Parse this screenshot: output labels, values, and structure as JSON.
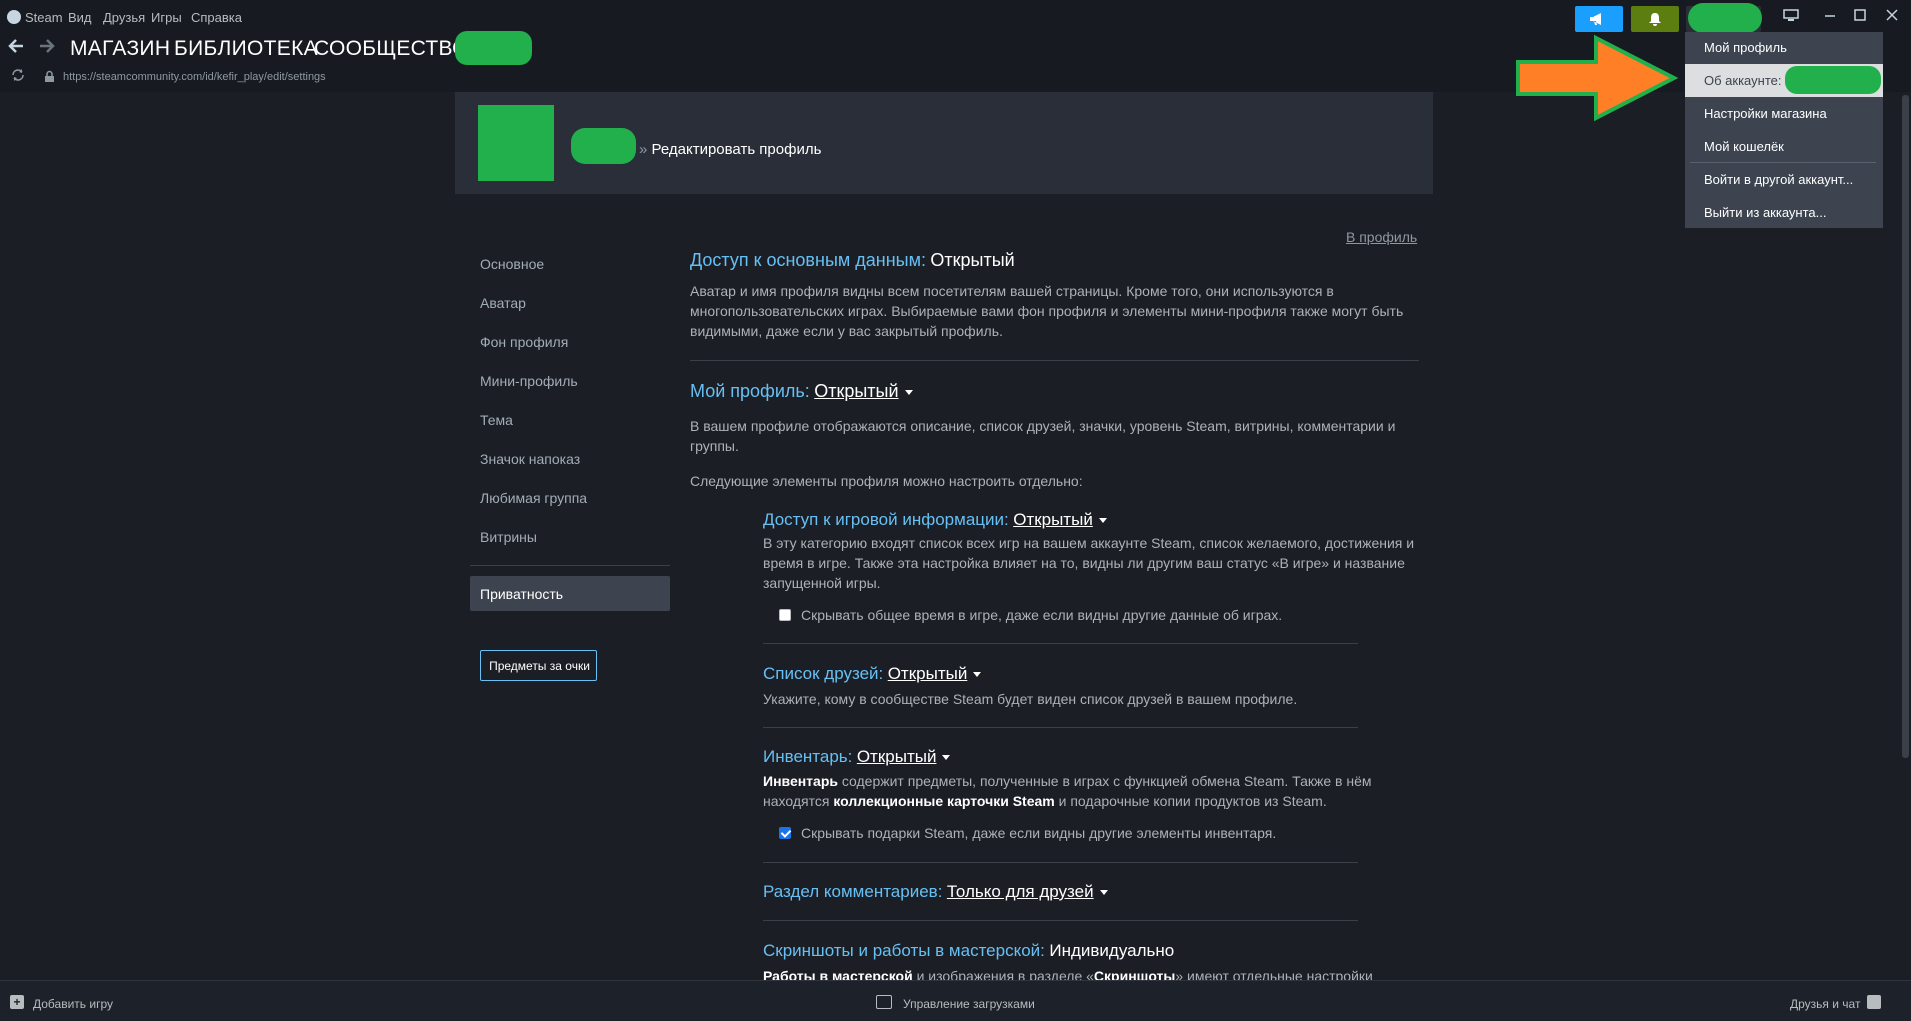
{
  "menubar": {
    "app_name": "Steam",
    "items": [
      "Вид",
      "Друзья",
      "Игры",
      "Справка"
    ]
  },
  "nav": {
    "links": [
      "МАГАЗИН",
      "БИБЛИОТЕКА",
      "СООБЩЕСТВО"
    ],
    "url": "https://steamcommunity.com/id/kefir_play/edit/settings"
  },
  "header": {
    "separator": "»",
    "edit_profile": "Редактировать профиль"
  },
  "to_profile_link": "В профиль",
  "sidebar": {
    "items": [
      "Основное",
      "Аватар",
      "Фон профиля",
      "Мини-профиль",
      "Тема",
      "Значок напоказ",
      "Любимая группа",
      "Витрины"
    ],
    "active": "Приватность",
    "points_button": "Предметы за очки"
  },
  "privacy": {
    "basic": {
      "label": "Доступ к основным данным:",
      "value": "Открытый",
      "desc_lines": [
        "Аватар и имя профиля видны всем посетителям вашей страницы. Кроме того, они используются в",
        "многопользовательских играх. Выбираемые вами фон профиля и элементы мини-профиля также могут быть",
        "видимыми, даже если у вас закрытый профиль."
      ]
    },
    "profile": {
      "label": "Мой профиль:",
      "value": "Открытый",
      "desc_lines": [
        "В вашем профиле отображаются описание, список друзей, значки, уровень Steam, витрины, комментарии и",
        "группы."
      ],
      "note": "Следующие элементы профиля можно настроить отдельно:"
    },
    "game_details": {
      "label": "Доступ к игровой информации:",
      "value": "Открытый",
      "desc_lines": [
        "В эту категорию входят список всех игр на вашем аккаунте Steam, список желаемого, достижения и",
        "время в игре. Также эта настройка влияет на то, видны ли другим ваш статус «В игре» и название",
        "запущенной игры."
      ],
      "checkbox_label": "Скрывать общее время в игре, даже если видны другие данные об играх.",
      "checked": false
    },
    "friends": {
      "label": "Список друзей:",
      "value": "Открытый",
      "desc": "Укажите, кому в сообществе Steam будет виден список друзей в вашем профиле."
    },
    "inventory": {
      "label": "Инвентарь:",
      "value": "Открытый",
      "line1_bold": "Инвентарь",
      "line1_rest": " содержит предметы, полученные в играх с функцией обмена Steam. Также в нём",
      "line2_pre": "находятся ",
      "line2_bold": "коллекционные карточки Steam",
      "line2_rest": " и подарочные копии продуктов из Steam.",
      "checkbox_label": "Скрывать подарки Steam, даже если видны другие элементы инвентаря.",
      "checked": true
    },
    "comments": {
      "label": "Раздел комментариев:",
      "value": "Только для друзей"
    },
    "screenshots": {
      "label": "Скриншоты и работы в мастерской:",
      "value": "Индивидуально",
      "line_bold1": "Работы в мастерской",
      "line_mid": " и изображения в разделе «",
      "line_bold2": "Скриншоты",
      "line_end": "» имеют отдельные настройки"
    }
  },
  "dropdown": {
    "items": [
      "Мой профиль",
      "Об аккаунте:",
      "Настройки магазина",
      "Мой кошелёк",
      "Войти в другой аккаунт...",
      "Выйти из аккаунта..."
    ],
    "hover_index": 1
  },
  "bottombar": {
    "add_game": "Добавить игру",
    "downloads": "Управление загрузками",
    "friends_chat": "Друзья и чат"
  },
  "colors": {
    "accent_blue": "#66c0f4",
    "mask_green": "#21b04b",
    "annotation_orange": "#ff7f27"
  }
}
